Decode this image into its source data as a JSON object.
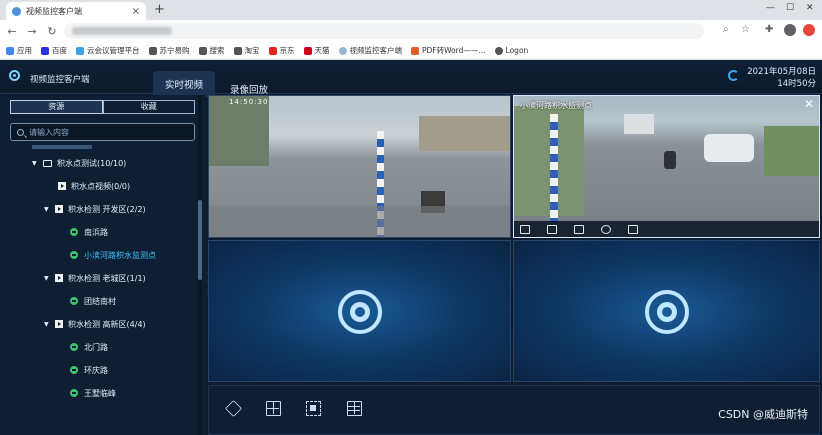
{
  "browser": {
    "tab_title": "视频监控客户端",
    "new_tab": "+",
    "bookmarks": [
      "应用",
      "百度",
      "云会议管理平台",
      "苏宁易购",
      "搜索",
      "淘宝",
      "京东",
      "天猫",
      "视频监控客户端",
      "PDF转Word——...",
      "Logon"
    ]
  },
  "app": {
    "title": "视频监控客户端",
    "nav": {
      "live_label": "实时视频",
      "playback_label": "录像回放"
    },
    "date": "2021年05月08日",
    "time": "14时50分"
  },
  "sidebar": {
    "tabs": [
      "资源",
      "收藏"
    ],
    "search_placeholder": "请输入内容",
    "tree": [
      {
        "label": "积水点测试(10/10)",
        "type": "folder"
      },
      {
        "label": "积水点视频(0/0)",
        "type": "group"
      },
      {
        "label": "积水检测 开发区(2/2)",
        "type": "group"
      },
      {
        "label": "南浜路",
        "type": "camera"
      },
      {
        "label": "小渎河路积水监测点",
        "type": "camera",
        "highlight": true
      },
      {
        "label": "积水检测 老城区(1/1)",
        "type": "group"
      },
      {
        "label": "团结南村",
        "type": "camera"
      },
      {
        "label": "积水检测 高新区(4/4)",
        "type": "group"
      },
      {
        "label": "北门路",
        "type": "camera"
      },
      {
        "label": "环庆路",
        "type": "camera"
      },
      {
        "label": "王墅临峰",
        "type": "camera"
      }
    ]
  },
  "video": {
    "selected_camera_title": "小渎河路积水监测点",
    "osd_time": "14:50:30"
  },
  "watermark": "CSDN @威迪斯特",
  "colors": {
    "accent": "#46c6ff",
    "camera_online": "#3ec36a",
    "background": "#0d1c30"
  }
}
